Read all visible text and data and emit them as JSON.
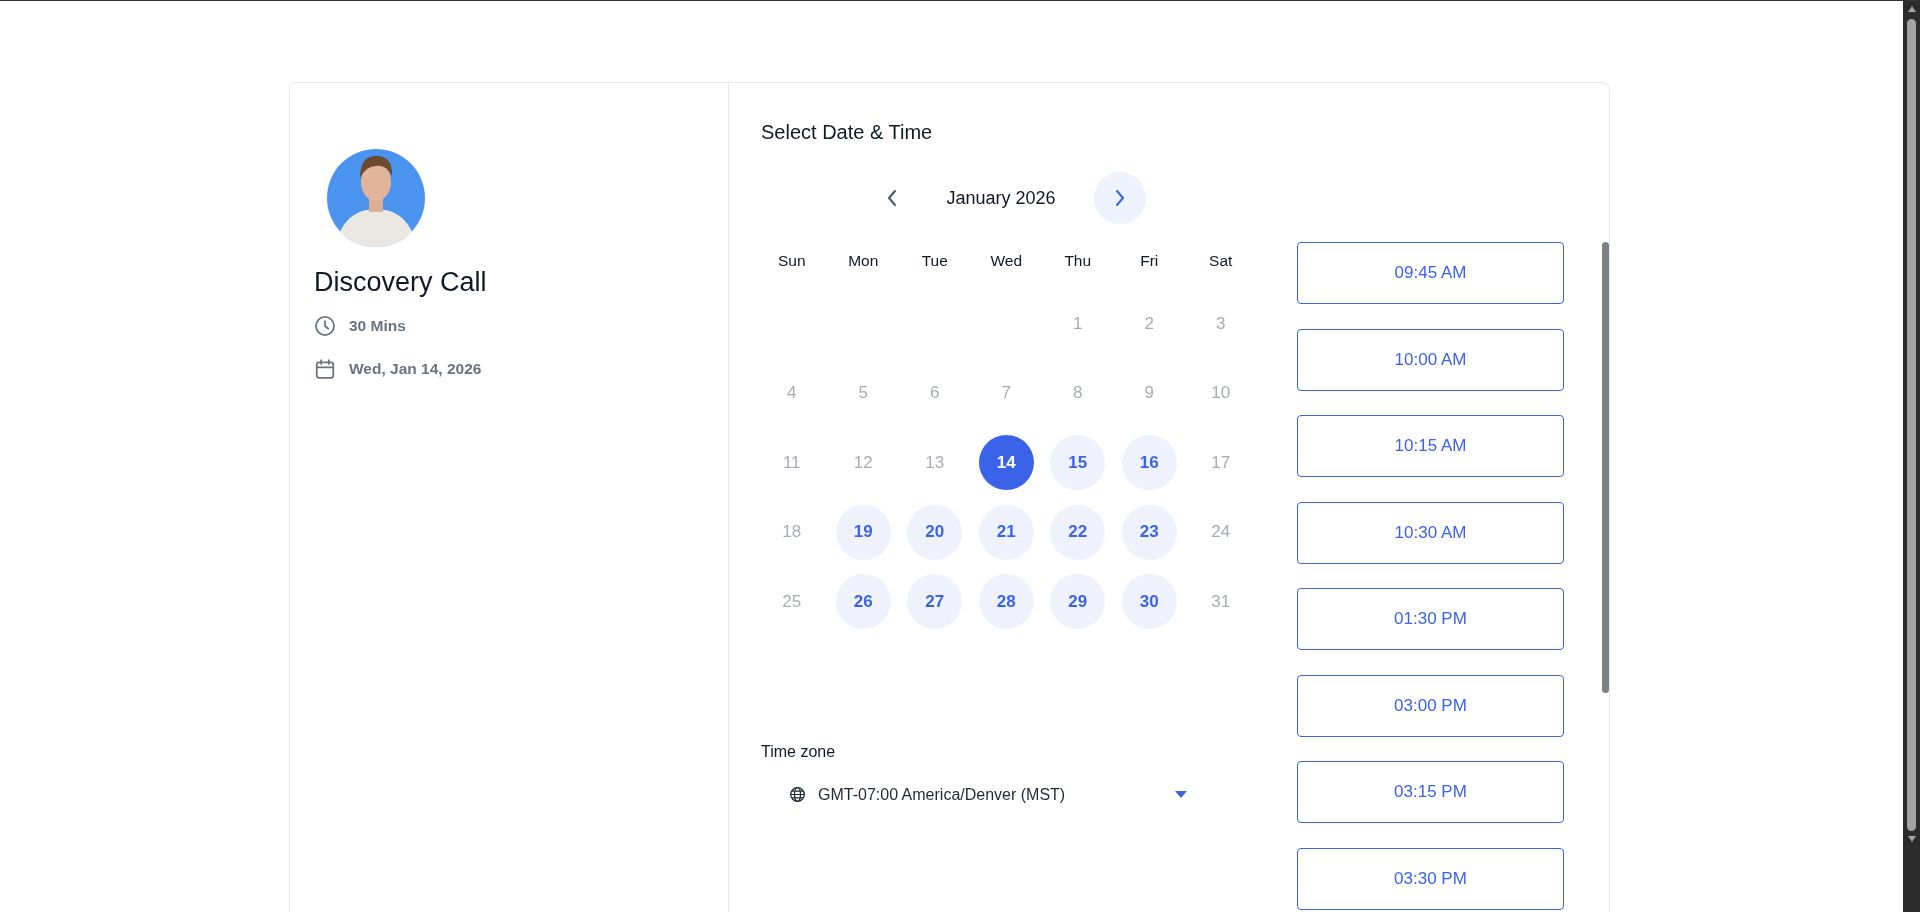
{
  "event": {
    "title": "Discovery Call",
    "details": [
      {
        "kind": "duration",
        "text": "30 Mins"
      },
      {
        "kind": "date",
        "text": "Wed, Jan 14, 2026"
      }
    ]
  },
  "scheduler": {
    "heading": "Select Date & Time",
    "month": "January 2026",
    "month_nav": {
      "previous": {
        "active": false
      },
      "next": {
        "active": true
      }
    },
    "weekdays": [
      "Sun",
      "Mon",
      "Tue",
      "Wed",
      "Thu",
      "Fri",
      "Sat"
    ],
    "weeks": [
      [
        {
          "day": "1",
          "available": false,
          "selected": false
        },
        {
          "day": "2",
          "available": false,
          "selected": false
        },
        {
          "day": "3",
          "available": false,
          "selected": false
        }
      ],
      [
        {
          "day": "4",
          "available": false,
          "selected": false
        },
        {
          "day": "5",
          "available": false,
          "selected": false
        },
        {
          "day": "6",
          "available": false,
          "selected": false
        },
        {
          "day": "7",
          "available": false,
          "selected": false
        },
        {
          "day": "8",
          "available": false,
          "selected": false
        },
        {
          "day": "9",
          "available": false,
          "selected": false
        },
        {
          "day": "10",
          "available": false,
          "selected": false
        }
      ],
      [
        {
          "day": "11",
          "available": false,
          "selected": false
        },
        {
          "day": "12",
          "available": false,
          "selected": false
        },
        {
          "day": "13",
          "available": false,
          "selected": false
        },
        {
          "day": "14",
          "available": true,
          "selected": true
        },
        {
          "day": "15",
          "available": true,
          "selected": false
        },
        {
          "day": "16",
          "available": true,
          "selected": false
        },
        {
          "day": "17",
          "available": false,
          "selected": false
        }
      ],
      [
        {
          "day": "18",
          "available": false,
          "selected": false
        },
        {
          "day": "19",
          "available": true,
          "selected": false
        },
        {
          "day": "20",
          "available": true,
          "selected": false
        },
        {
          "day": "21",
          "available": true,
          "selected": false
        },
        {
          "day": "22",
          "available": true,
          "selected": false
        },
        {
          "day": "23",
          "available": true,
          "selected": false
        },
        {
          "day": "24",
          "available": false,
          "selected": false
        }
      ],
      [
        {
          "day": "25",
          "available": false,
          "selected": false
        },
        {
          "day": "26",
          "available": true,
          "selected": false
        },
        {
          "day": "27",
          "available": true,
          "selected": false
        },
        {
          "day": "28",
          "available": true,
          "selected": false
        },
        {
          "day": "29",
          "available": true,
          "selected": false
        },
        {
          "day": "30",
          "available": true,
          "selected": false
        },
        {
          "day": "31",
          "available": false,
          "selected": false
        }
      ]
    ]
  },
  "timezone": {
    "label": "Time zone",
    "value": "GMT-07:00 America/Denver (MST)"
  },
  "time_slots": [
    {
      "time": "09:45 AM"
    },
    {
      "time": "10:00 AM"
    },
    {
      "time": "10:15 AM"
    },
    {
      "time": "10:30 AM"
    },
    {
      "time": "01:30 PM"
    },
    {
      "time": "03:00 PM"
    },
    {
      "time": "03:15 PM"
    },
    {
      "time": "03:30 PM"
    }
  ]
}
